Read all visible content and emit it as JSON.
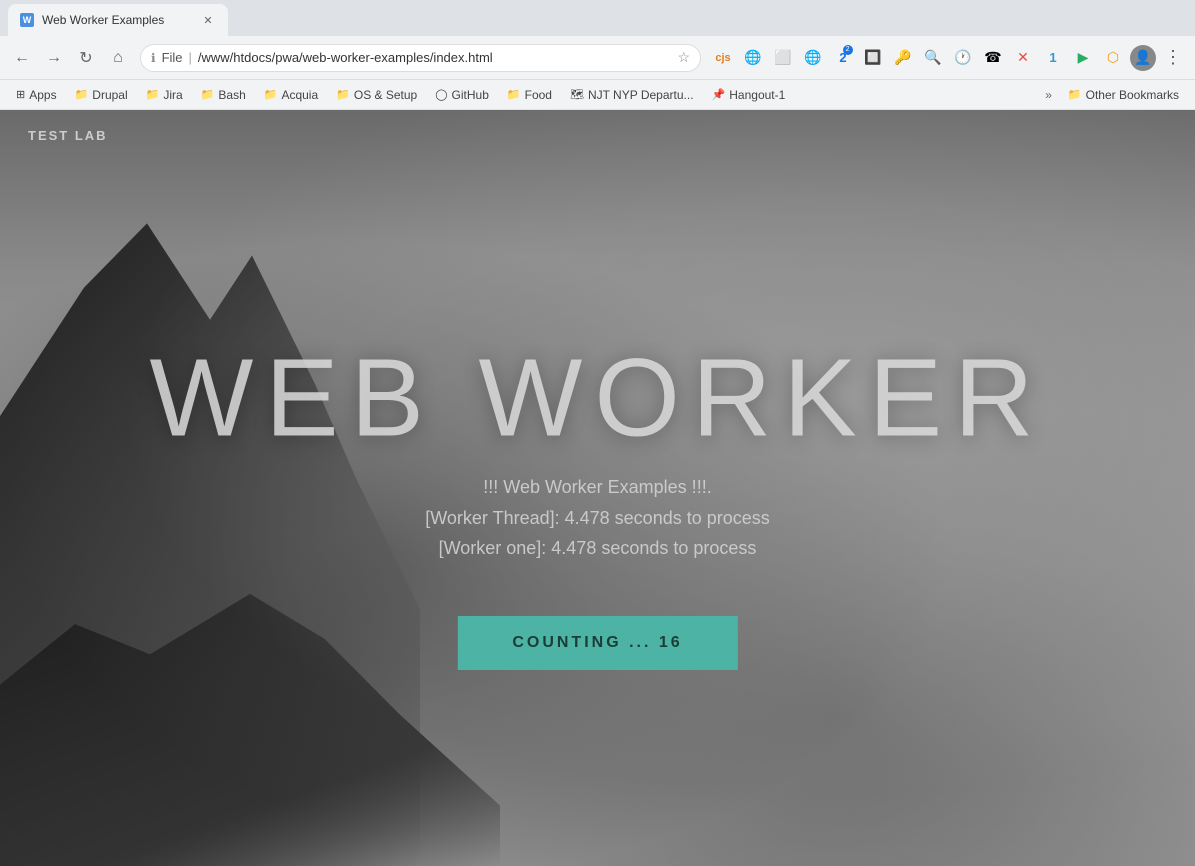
{
  "browser": {
    "tab": {
      "title": "Web Worker Examples",
      "favicon": "W"
    },
    "address": "/www/htdocs/pwa/web-worker-examples/index.html",
    "protocol": "File",
    "nav": {
      "back_disabled": false,
      "forward_disabled": false
    }
  },
  "bookmarks": {
    "items": [
      {
        "id": "apps",
        "label": "Apps",
        "icon": "⊞"
      },
      {
        "id": "drupal",
        "label": "Drupal",
        "icon": "📁"
      },
      {
        "id": "jira",
        "label": "Jira",
        "icon": "📁"
      },
      {
        "id": "bash",
        "label": "Bash",
        "icon": "📁"
      },
      {
        "id": "acquia",
        "label": "Acquia",
        "icon": "📁"
      },
      {
        "id": "os-setup",
        "label": "OS & Setup",
        "icon": "📁"
      },
      {
        "id": "github",
        "label": "GitHub",
        "icon": "◯"
      },
      {
        "id": "food",
        "label": "Food",
        "icon": "📁"
      },
      {
        "id": "njt",
        "label": "NJT NYP Departu...",
        "icon": "🗺"
      },
      {
        "id": "hangout",
        "label": "Hangout-1",
        "icon": "📌"
      }
    ],
    "more_label": "»",
    "other_label": "Other Bookmarks",
    "other_icon": "📁"
  },
  "page": {
    "app_label": "TEST LAB",
    "hero_title": "WEB WORKER",
    "subtitle_line1": "!!! Web Worker Examples !!!.",
    "subtitle_line2": "[Worker Thread]: 4.478 seconds to process",
    "subtitle_line3": "[Worker one]: 4.478 seconds to process",
    "counting_button": "COUNTING ... 16",
    "counting_color": "#4db3a4"
  }
}
